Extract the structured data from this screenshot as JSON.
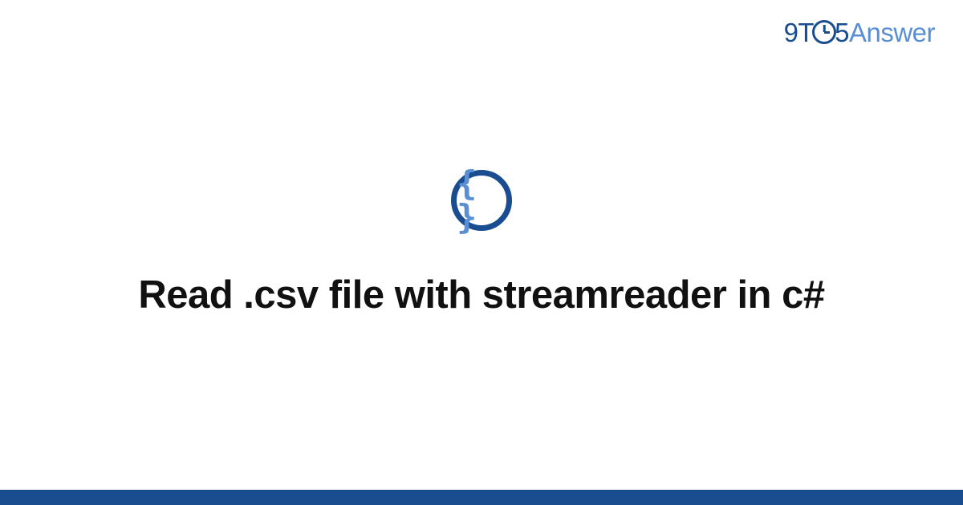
{
  "logo": {
    "part1": "9T",
    "part2": "5",
    "part3": "Answer"
  },
  "icon": {
    "braces": "{ }"
  },
  "title": "Read .csv file with streamreader in c#",
  "colors": {
    "primary": "#1a4d8f",
    "secondary": "#5a8fd4"
  }
}
